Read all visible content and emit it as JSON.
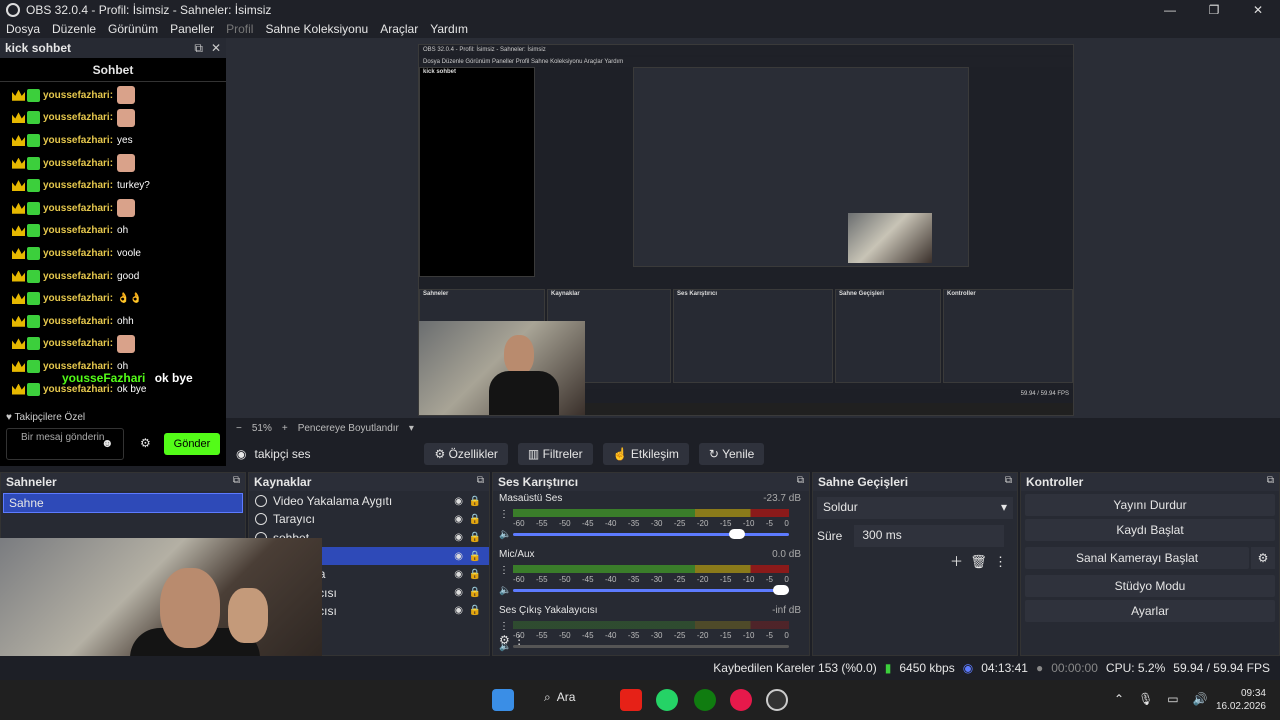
{
  "window": {
    "title": "OBS 32.0.4 - Profil: İsimsiz - Sahneler: İsimsiz",
    "minimize": "—",
    "maximize": "❐",
    "close": "✕"
  },
  "menu": [
    "Dosya",
    "Düzenle",
    "Görünüm",
    "Paneller",
    "Profil",
    "Sahne Koleksiyonu",
    "Araçlar",
    "Yardım"
  ],
  "chat": {
    "dock_title": "kick sohbet",
    "header": "Sohbet",
    "messages": [
      {
        "user": "youssefazhari:",
        "text": ""
      },
      {
        "user": "youssefazhari:",
        "text": ""
      },
      {
        "user": "youssefazhari:",
        "text": "yes"
      },
      {
        "user": "youssefazhari:",
        "text": ""
      },
      {
        "user": "youssefazhari:",
        "text": "turkey?"
      },
      {
        "user": "youssefazhari:",
        "text": ""
      },
      {
        "user": "youssefazhari:",
        "text": "oh"
      },
      {
        "user": "youssefazhari:",
        "text": "voole"
      },
      {
        "user": "youssefazhari:",
        "text": "good"
      },
      {
        "user": "youssefazhari:",
        "text": "👌👌"
      },
      {
        "user": "youssefazhari:",
        "text": "ohh"
      },
      {
        "user": "youssefazhari:",
        "text": ""
      },
      {
        "user": "youssefazhari:",
        "text": "oh"
      },
      {
        "user": "youssefazhari:",
        "text": "ok bye"
      }
    ],
    "overlay_user": "yousseFazhari",
    "overlay_text": "ok bye",
    "followers_only": "♥ Takipçilere Özel",
    "input_placeholder": "Bir mesaj gönderin",
    "send_label": "Gönder"
  },
  "zoom": {
    "minus": "−",
    "value": "51%",
    "plus": "+",
    "fit": "Pencereye Boyutlandır"
  },
  "source_bar": {
    "current": "takipçi ses",
    "properties": "Özellikler",
    "filters": "Filtreler",
    "interact": "Etkileşim",
    "refresh": "Yenile"
  },
  "scenes": {
    "title": "Sahneler",
    "items": [
      "Sahne"
    ]
  },
  "sources": {
    "title": "Kaynaklar",
    "items": [
      {
        "name": "Video Yakalama Aygıtı",
        "selected": false
      },
      {
        "name": "Tarayıcı",
        "selected": false
      },
      {
        "name": "sohbet",
        "selected": false
      },
      {
        "name": "",
        "selected": true
      },
      {
        "name": "Yakalama",
        "selected": false
      },
      {
        "name": "Yakalayıcısı",
        "selected": false
      },
      {
        "name": "Yakalayıcısı",
        "selected": false
      }
    ]
  },
  "mixer": {
    "title": "Ses Karıştırıcı",
    "channels": [
      {
        "name": "Masaüstü Ses",
        "db": "-23.7 dB",
        "level": 0.83
      },
      {
        "name": "Mic/Aux",
        "db": "0.0 dB",
        "level": 1.0
      },
      {
        "name": "Ses Çıkış Yakalayıcısı",
        "db": "-inf dB",
        "level": 0.0
      }
    ],
    "ticks": [
      "-60",
      "-55",
      "-50",
      "-45",
      "-40",
      "-35",
      "-30",
      "-25",
      "-20",
      "-15",
      "-10",
      "-5",
      "0"
    ]
  },
  "transitions": {
    "title": "Sahne Geçişleri",
    "selected": "Soldur",
    "duration_label": "Süre",
    "duration": "300 ms"
  },
  "controls": {
    "title": "Kontroller",
    "buttons": [
      "Yayını Durdur",
      "Kaydı Başlat",
      "Sanal Kamerayı Başlat",
      "Stüdyo Modu",
      "Ayarlar"
    ]
  },
  "status": {
    "dropped": "Kaybedilen Kareler 153 (%0.0)",
    "bitrate": "6450 kbps",
    "stream_time": "04:13:41",
    "rec_time": "00:00:00",
    "cpu": "CPU: 5.2%",
    "fps": "59.94 / 59.94 FPS"
  },
  "taskbar": {
    "search": "Ara",
    "time": "09:34",
    "date": "16.02.2026"
  },
  "colors": {
    "accent": "#5d7bff",
    "kick_green": "#53fc18",
    "scene_selected": "#2e4ab8"
  }
}
